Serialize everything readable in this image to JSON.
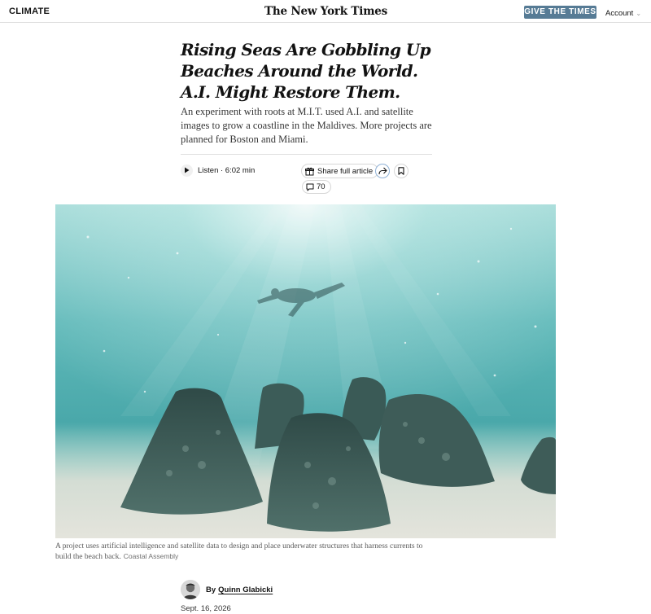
{
  "topbar": {
    "section": "CLIMATE",
    "masthead": "The New York Times",
    "give_button": "GIVE THE TIMES",
    "account": "Account"
  },
  "article": {
    "headline_lines": [
      "Rising Seas Are Gobbling Up",
      "Beaches Around the World.",
      "A.I. Might Restore Them."
    ],
    "summary": "An experiment with roots at M.I.T. used A.I. and satellite images to grow a coastline in the Maldives. More projects are planned for Boston and Miami.",
    "listen_label": "Listen · 6:02 min",
    "share_label": "Share full article",
    "comments_count": "70",
    "caption": "A project uses artificial intelligence and satellite data to design and place underwater structures that harness currents to build the beach back.",
    "caption_credit": "Coastal Assembly",
    "byline_prefix": "By",
    "author": "Quinn Glabicki",
    "date": "Sept. 16, 2026"
  },
  "icons": {
    "play": "play-icon",
    "gift": "gift-icon",
    "forward": "share-arrow-icon",
    "bookmark": "bookmark-icon",
    "comment": "comment-bubble-icon",
    "account_chevron": "chevron-down-icon"
  },
  "colors": {
    "give_button_bg": "#567b95",
    "water_light": "#bfe6e4",
    "water_deep": "#3f9fa3",
    "sand": "#dcdcd2",
    "rock": "#3e5a56"
  }
}
